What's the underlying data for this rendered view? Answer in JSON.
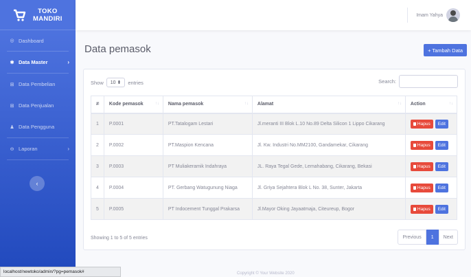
{
  "brand": {
    "line1": "TOKO",
    "line2": "MANDIRI"
  },
  "sidebar": {
    "items": [
      {
        "icon": "◎",
        "label": "Dashboard"
      },
      {
        "icon": "✱",
        "label": "Data Master"
      },
      {
        "icon": "⊞",
        "label": "Data Pembelian"
      },
      {
        "icon": "⊞",
        "label": "Data Penjualan"
      },
      {
        "icon": "♟",
        "label": "Data Pengguna"
      },
      {
        "icon": "⊖",
        "label": "Laporan"
      }
    ],
    "caret": "›",
    "toggle": "‹"
  },
  "topbar": {
    "user_name": "Imam Yahya"
  },
  "page": {
    "title": "Data pemasok",
    "add_button": "+ Tambah Data"
  },
  "table": {
    "show_label": "Show",
    "entries_value": "10",
    "entries_label": "entries",
    "search_label": "Search:",
    "headers": [
      "#",
      "Kode pemasok",
      "Nama pemasok",
      "Alamat",
      "Action"
    ],
    "rows": [
      {
        "no": "1",
        "kode": "P.0001",
        "nama": "PT.Tatalogam Lestari",
        "alamat": "Jl.meranti III Blok L.10 No.89 Delta Silicon 1 Lippo Cikarang"
      },
      {
        "no": "2",
        "kode": "P.0002",
        "nama": "PT.Maspion Kencana",
        "alamat": "Jl. Kw. Industri No.MM2100, Gandamekar, Cikarang"
      },
      {
        "no": "3",
        "kode": "P.0003",
        "nama": "PT Muliakeramik Indahraya",
        "alamat": "JL. Raya Tegal Gede, Lemahabang, Cikarang, Bekasi"
      },
      {
        "no": "4",
        "kode": "P.0004",
        "nama": "PT. Gerbang Watugunung Niaga",
        "alamat": "Jl. Griya Sejahtera Blok L No. 38, Sunter, Jakarta"
      },
      {
        "no": "5",
        "kode": "P.0005",
        "nama": "PT Indocement Tunggal Prakarsa",
        "alamat": "Jl.Mayor Oking Jayaatmaja, Citeureup, Bogor"
      }
    ],
    "delete_label": "Hapus",
    "edit_label": "Edit",
    "info": "Showing 1 to 5 of 5 entries",
    "pagination": {
      "previous": "Previous",
      "current": "1",
      "next": "Next"
    }
  },
  "statusbar": {
    "url": "localhost/newtoko/admin/?pg=pemasok#"
  },
  "footer": {
    "text": "Copyright © Your Website 2020"
  },
  "colors": {
    "primary": "#4e73df",
    "danger": "#e74a3b"
  }
}
